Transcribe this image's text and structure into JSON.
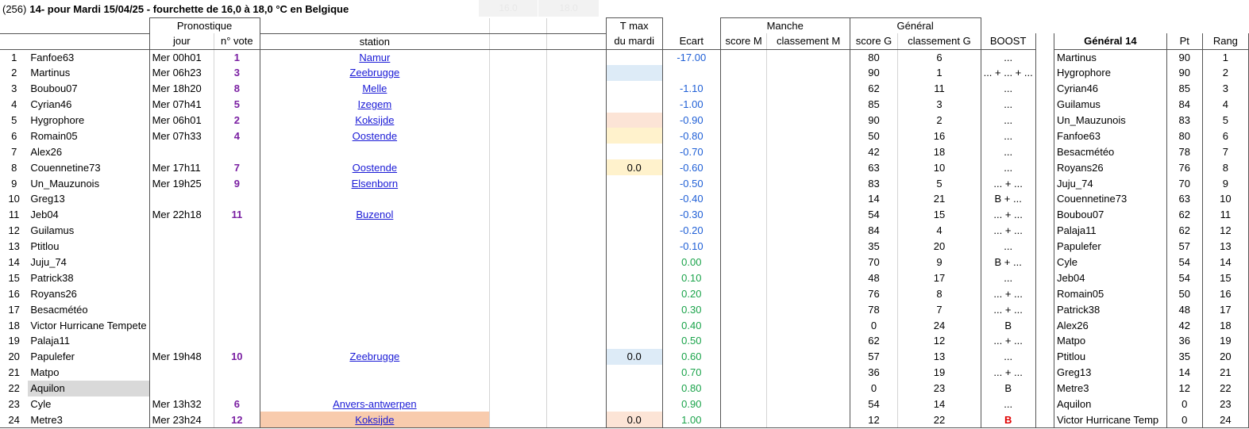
{
  "title": {
    "prefix": "(256)",
    "text": "14- pour Mardi 15/04/25 - fourchette de 16,0 à 18,0 °C en Belgique",
    "range_low": "16.0",
    "range_high": "18.0"
  },
  "headers": {
    "pronostique": "Pronostique",
    "jour": "jour",
    "n_vote": "n° vote",
    "station": "station",
    "tmax": "T max",
    "du_mardi": "du mardi",
    "ecart": "Ecart",
    "manche": "Manche",
    "score_m": "score M",
    "classement_m": "classement M",
    "general": "Général",
    "score_g": "score G",
    "classement_g": "classement G",
    "boost": "BOOST",
    "general14": "Général 14",
    "pt": "Pt",
    "rang": "Rang"
  },
  "rows": [
    {
      "n": "1",
      "name": "Fanfoe63",
      "jour": "Mer 00h01",
      "vote": "1",
      "station": "Namur",
      "tmax": "",
      "ecart": "-17.00",
      "score_m": "",
      "class_m": "",
      "score_g": "80",
      "class_g": "6",
      "boost": "...",
      "g14_name": "Martinus",
      "g14_pt": "90",
      "g14_rang": "1"
    },
    {
      "n": "2",
      "name": "Martinus",
      "jour": "Mer 06h23",
      "vote": "3",
      "station": "Zeebrugge",
      "tmax": "",
      "ecart": "",
      "score_m": "",
      "class_m": "",
      "score_g": "90",
      "class_g": "1",
      "boost": "... + ... + ...",
      "g14_name": "Hygrophore",
      "g14_pt": "90",
      "g14_rang": "2"
    },
    {
      "n": "3",
      "name": "Boubou07",
      "jour": "Mer 18h20",
      "vote": "8",
      "station": "Melle",
      "tmax": "",
      "ecart": "-1.10",
      "score_m": "",
      "class_m": "",
      "score_g": "62",
      "class_g": "11",
      "boost": "...",
      "g14_name": "Cyrian46",
      "g14_pt": "85",
      "g14_rang": "3"
    },
    {
      "n": "4",
      "name": "Cyrian46",
      "jour": "Mer 07h41",
      "vote": "5",
      "station": "Izegem",
      "tmax": "",
      "ecart": "-1.00",
      "score_m": "",
      "class_m": "",
      "score_g": "85",
      "class_g": "3",
      "boost": "...",
      "g14_name": "Guilamus",
      "g14_pt": "84",
      "g14_rang": "4"
    },
    {
      "n": "5",
      "name": "Hygrophore",
      "jour": "Mer 06h01",
      "vote": "2",
      "station": "Koksijde",
      "tmax": "",
      "ecart": "-0.90",
      "score_m": "",
      "class_m": "",
      "score_g": "90",
      "class_g": "2",
      "boost": "...",
      "g14_name": "Un_Mauzunois",
      "g14_pt": "83",
      "g14_rang": "5"
    },
    {
      "n": "6",
      "name": "Romain05",
      "jour": "Mer 07h33",
      "vote": "4",
      "station": "Oostende",
      "tmax": "",
      "ecart": "-0.80",
      "score_m": "",
      "class_m": "",
      "score_g": "50",
      "class_g": "16",
      "boost": "...",
      "g14_name": "Fanfoe63",
      "g14_pt": "80",
      "g14_rang": "6"
    },
    {
      "n": "7",
      "name": "Alex26",
      "jour": "",
      "vote": "",
      "station": "",
      "tmax": "",
      "ecart": "-0.70",
      "score_m": "",
      "class_m": "",
      "score_g": "42",
      "class_g": "18",
      "boost": "...",
      "g14_name": "Besacmétéo",
      "g14_pt": "78",
      "g14_rang": "7"
    },
    {
      "n": "8",
      "name": "Couennetine73",
      "jour": "Mer 17h11",
      "vote": "7",
      "station": "Oostende",
      "tmax": "0.0",
      "ecart": "-0.60",
      "score_m": "",
      "class_m": "",
      "score_g": "63",
      "class_g": "10",
      "boost": "...",
      "g14_name": "Royans26",
      "g14_pt": "76",
      "g14_rang": "8"
    },
    {
      "n": "9",
      "name": "Un_Mauzunois",
      "jour": "Mer 19h25",
      "vote": "9",
      "station": "Elsenborn",
      "tmax": "",
      "ecart": "-0.50",
      "score_m": "",
      "class_m": "",
      "score_g": "83",
      "class_g": "5",
      "boost": "... + ...",
      "g14_name": "Juju_74",
      "g14_pt": "70",
      "g14_rang": "9"
    },
    {
      "n": "10",
      "name": "Greg13",
      "jour": "",
      "vote": "",
      "station": "",
      "tmax": "",
      "ecart": "-0.40",
      "score_m": "",
      "class_m": "",
      "score_g": "14",
      "class_g": "21",
      "boost": "B + ...",
      "g14_name": "Couennetine73",
      "g14_pt": "63",
      "g14_rang": "10"
    },
    {
      "n": "11",
      "name": "Jeb04",
      "jour": "Mer 22h18",
      "vote": "11",
      "station": "Buzenol",
      "tmax": "",
      "ecart": "-0.30",
      "score_m": "",
      "class_m": "",
      "score_g": "54",
      "class_g": "15",
      "boost": "... + ...",
      "g14_name": "Boubou07",
      "g14_pt": "62",
      "g14_rang": "11"
    },
    {
      "n": "12",
      "name": "Guilamus",
      "jour": "",
      "vote": "",
      "station": "",
      "tmax": "",
      "ecart": "-0.20",
      "score_m": "",
      "class_m": "",
      "score_g": "84",
      "class_g": "4",
      "boost": "... + ...",
      "g14_name": "Palaja11",
      "g14_pt": "62",
      "g14_rang": "12"
    },
    {
      "n": "13",
      "name": "Ptitlou",
      "jour": "",
      "vote": "",
      "station": "",
      "tmax": "",
      "ecart": "-0.10",
      "score_m": "",
      "class_m": "",
      "score_g": "35",
      "class_g": "20",
      "boost": "...",
      "g14_name": "Papulefer",
      "g14_pt": "57",
      "g14_rang": "13"
    },
    {
      "n": "14",
      "name": "Juju_74",
      "jour": "",
      "vote": "",
      "station": "",
      "tmax": "",
      "ecart": "0.00",
      "score_m": "",
      "class_m": "",
      "score_g": "70",
      "class_g": "9",
      "boost": "B + ...",
      "g14_name": "Cyle",
      "g14_pt": "54",
      "g14_rang": "14"
    },
    {
      "n": "15",
      "name": "Patrick38",
      "jour": "",
      "vote": "",
      "station": "",
      "tmax": "",
      "ecart": "0.10",
      "score_m": "",
      "class_m": "",
      "score_g": "48",
      "class_g": "17",
      "boost": "...",
      "g14_name": "Jeb04",
      "g14_pt": "54",
      "g14_rang": "15"
    },
    {
      "n": "16",
      "name": "Royans26",
      "jour": "",
      "vote": "",
      "station": "",
      "tmax": "",
      "ecart": "0.20",
      "score_m": "",
      "class_m": "",
      "score_g": "76",
      "class_g": "8",
      "boost": "... + ...",
      "g14_name": "Romain05",
      "g14_pt": "50",
      "g14_rang": "16"
    },
    {
      "n": "17",
      "name": "Besacmétéo",
      "jour": "",
      "vote": "",
      "station": "",
      "tmax": "",
      "ecart": "0.30",
      "score_m": "",
      "class_m": "",
      "score_g": "78",
      "class_g": "7",
      "boost": "... + ...",
      "g14_name": "Patrick38",
      "g14_pt": "48",
      "g14_rang": "17"
    },
    {
      "n": "18",
      "name": "Victor Hurricane Tempete",
      "jour": "",
      "vote": "",
      "station": "",
      "tmax": "",
      "ecart": "0.40",
      "score_m": "",
      "class_m": "",
      "score_g": "0",
      "class_g": "24",
      "boost": "B",
      "g14_name": "Alex26",
      "g14_pt": "42",
      "g14_rang": "18"
    },
    {
      "n": "19",
      "name": "Palaja11",
      "jour": "",
      "vote": "",
      "station": "",
      "tmax": "",
      "ecart": "0.50",
      "score_m": "",
      "class_m": "",
      "score_g": "62",
      "class_g": "12",
      "boost": "... + ...",
      "g14_name": "Matpo",
      "g14_pt": "36",
      "g14_rang": "19"
    },
    {
      "n": "20",
      "name": "Papulefer",
      "jour": "Mer 19h48",
      "vote": "10",
      "station": "Zeebrugge",
      "tmax": "0.0",
      "ecart": "0.60",
      "score_m": "",
      "class_m": "",
      "score_g": "57",
      "class_g": "13",
      "boost": "...",
      "g14_name": "Ptitlou",
      "g14_pt": "35",
      "g14_rang": "20"
    },
    {
      "n": "21",
      "name": "Matpo",
      "jour": "",
      "vote": "",
      "station": "",
      "tmax": "",
      "ecart": "0.70",
      "score_m": "",
      "class_m": "",
      "score_g": "36",
      "class_g": "19",
      "boost": "... + ...",
      "g14_name": "Greg13",
      "g14_pt": "14",
      "g14_rang": "21"
    },
    {
      "n": "22",
      "name": "Aquilon",
      "jour": "",
      "vote": "",
      "station": "",
      "tmax": "",
      "ecart": "0.80",
      "score_m": "",
      "class_m": "",
      "score_g": "0",
      "class_g": "23",
      "boost": "B",
      "g14_name": "Metre3",
      "g14_pt": "12",
      "g14_rang": "22"
    },
    {
      "n": "23",
      "name": "Cyle",
      "jour": "Mer 13h32",
      "vote": "6",
      "station": "Anvers-antwerpen",
      "tmax": "",
      "ecart": "0.90",
      "score_m": "",
      "class_m": "",
      "score_g": "54",
      "class_g": "14",
      "boost": "...",
      "g14_name": "Aquilon",
      "g14_pt": "0",
      "g14_rang": "23"
    },
    {
      "n": "24",
      "name": "Metre3",
      "jour": "Mer 23h24",
      "vote": "12",
      "station": "Koksijde",
      "tmax": "0.0",
      "ecart": "1.00",
      "score_m": "",
      "class_m": "",
      "score_g": "12",
      "class_g": "22",
      "boost": "B",
      "g14_name": "Victor Hurricane Temp",
      "g14_pt": "0",
      "g14_rang": "24"
    }
  ],
  "colors": {
    "ecart_negative": "#1f5fd6",
    "ecart_positive": "#1aa34a",
    "vote": "#7a1fa2",
    "link": "#1a1ad6",
    "boost_red": "#e00000"
  }
}
